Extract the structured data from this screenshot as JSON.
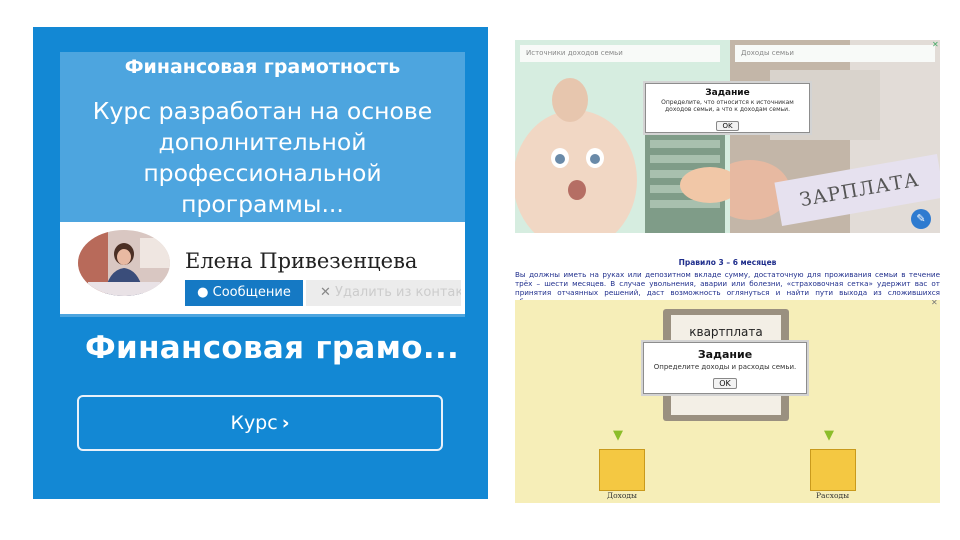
{
  "course_card": {
    "title": "Финансовая грамотность",
    "description": "Курс разработан на основе дополнительной профессиональной программы...",
    "author_name": "Елена Привезенцева",
    "message_button": "Сообщение",
    "delete_button": "Удалить из контак",
    "big_title": "Финансовая грамо...",
    "course_button": "Курс"
  },
  "game_income": {
    "field_left_placeholder": "Источники доходов семьи",
    "field_right_placeholder": "Доходы семьи",
    "dialog_title": "Задание",
    "dialog_text": "Определите, что относится к источникам доходов семьи, а что к доходам семьи.",
    "ok_label": "OK",
    "salary_card": "ЗАРПЛАТА"
  },
  "rule": {
    "title": "Правило 3 – 6 месяцев",
    "text": "Вы должны иметь на руках или депозитном вкладе сумму, достаточную для проживания семьи в течение трёх – шести месяцев. В случае увольнения, аварии или болезни, «страховочная сетка» удержит вас от принятия отчаянных решений, даст возможность оглянуться и найти пути выхода из сложившихся обстоятельств."
  },
  "game_budget": {
    "note_label": "квартплата",
    "dialog_title": "Задание",
    "dialog_text": "Определите доходы и расходы семьи.",
    "ok_label": "OK",
    "box_income": "Доходы",
    "box_expense": "Расходы"
  },
  "colors": {
    "card_blue": "#1388d4",
    "card_inner": "#4da5df",
    "button_blue": "#1579c4",
    "rule_text": "#1f2e8c",
    "game_bg_yellow": "#f6eeb8"
  },
  "icons": [
    "chat-bubble-icon",
    "close-icon",
    "chevron-right-icon",
    "edit-icon",
    "arrow-down-icon",
    "box-icon"
  ]
}
